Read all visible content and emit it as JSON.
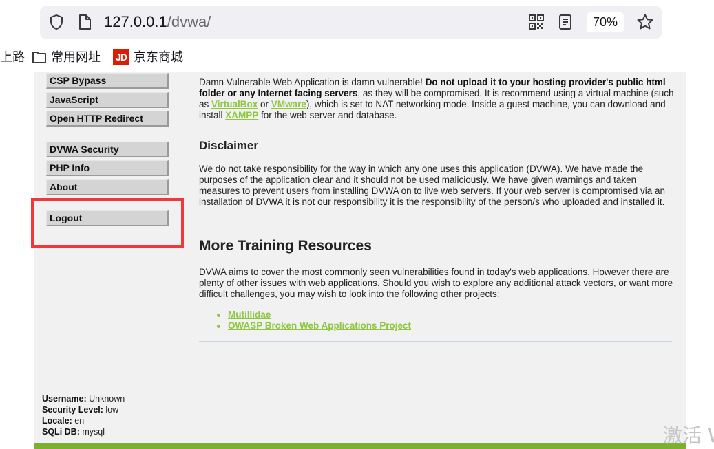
{
  "browser": {
    "url_host": "127.0.0.1",
    "url_path": "/dvwa/",
    "zoom": "70%",
    "bookmarks": [
      {
        "label": "上路"
      },
      {
        "label": "常用网址"
      },
      {
        "label": "京东商城",
        "badge": "JD"
      }
    ]
  },
  "sidebar": {
    "items": [
      {
        "label": "CSP Bypass"
      },
      {
        "label": "JavaScript"
      },
      {
        "label": "Open HTTP Redirect"
      },
      {
        "label": "DVWA Security"
      },
      {
        "label": "PHP Info"
      },
      {
        "label": "About"
      },
      {
        "label": "Logout"
      }
    ]
  },
  "main": {
    "intro": {
      "t1": "Damn Vulnerable Web Application is damn vulnerable! ",
      "t2": "Do not upload it to your hosting provider's public html folder or any Internet facing servers",
      "t3": ", as they will be compromised. It is recommend using a virtual machine (such as ",
      "link1": "VirtualBox",
      "t4": " or ",
      "link2": "VMware",
      "t5": "), which is set to NAT networking mode. Inside a guest machine, you can download and install ",
      "link3": "XAMPP",
      "t6": " for the web server and database."
    },
    "disclaimer_title": "Disclaimer",
    "disclaimer_text": "We do not take responsibility for the way in which any one uses this application (DVWA). We have made the purposes of the application clear and it should not be used maliciously. We have given warnings and taken measures to prevent users from installing DVWA on to live web servers. If your web server is compromised via an installation of DVWA it is not our responsibility it is the responsibility of the person/s who uploaded and installed it.",
    "resources_title": "More Training Resources",
    "resources_text": "DVWA aims to cover the most commonly seen vulnerabilities found in today's web applications. However there are plenty of other issues with web applications. Should you wish to explore any additional attack vectors, or want more difficult challenges, you may wish to look into the following other projects:",
    "resources_links": [
      {
        "label": "Mutillidae"
      },
      {
        "label": "OWASP Broken Web Applications Project"
      }
    ]
  },
  "status": {
    "username_label": "Username:",
    "username": "Unknown",
    "security_label": "Security Level:",
    "security": "low",
    "locale_label": "Locale:",
    "locale": "en",
    "sqli_label": "SQLi DB:",
    "sqli": "mysql"
  },
  "overlay": {
    "watermark": "激活 W"
  },
  "colors": {
    "accent_green": "#8dc63f",
    "highlight_red": "#f0373c",
    "footer_green": "#7bb130"
  }
}
